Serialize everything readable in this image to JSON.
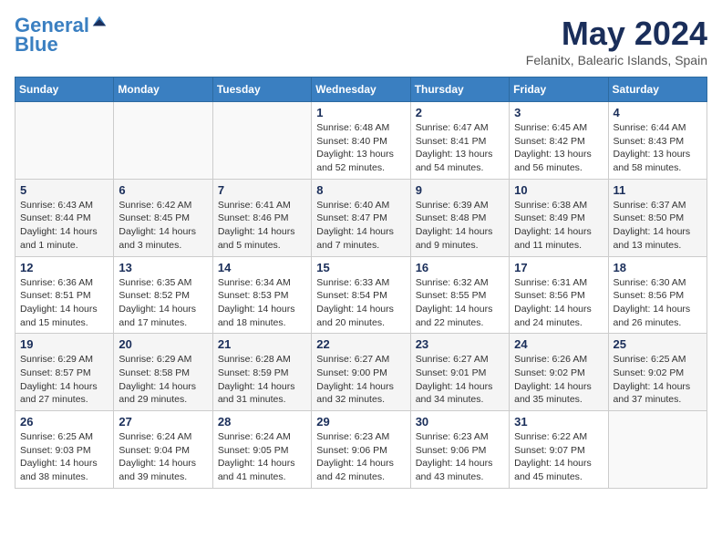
{
  "header": {
    "logo_line1": "General",
    "logo_line2": "Blue",
    "month": "May 2024",
    "location": "Felanitx, Balearic Islands, Spain"
  },
  "days_of_week": [
    "Sunday",
    "Monday",
    "Tuesday",
    "Wednesday",
    "Thursday",
    "Friday",
    "Saturday"
  ],
  "weeks": [
    [
      {
        "day": "",
        "info": ""
      },
      {
        "day": "",
        "info": ""
      },
      {
        "day": "",
        "info": ""
      },
      {
        "day": "1",
        "info": "Sunrise: 6:48 AM\nSunset: 8:40 PM\nDaylight: 13 hours\nand 52 minutes."
      },
      {
        "day": "2",
        "info": "Sunrise: 6:47 AM\nSunset: 8:41 PM\nDaylight: 13 hours\nand 54 minutes."
      },
      {
        "day": "3",
        "info": "Sunrise: 6:45 AM\nSunset: 8:42 PM\nDaylight: 13 hours\nand 56 minutes."
      },
      {
        "day": "4",
        "info": "Sunrise: 6:44 AM\nSunset: 8:43 PM\nDaylight: 13 hours\nand 58 minutes."
      }
    ],
    [
      {
        "day": "5",
        "info": "Sunrise: 6:43 AM\nSunset: 8:44 PM\nDaylight: 14 hours\nand 1 minute."
      },
      {
        "day": "6",
        "info": "Sunrise: 6:42 AM\nSunset: 8:45 PM\nDaylight: 14 hours\nand 3 minutes."
      },
      {
        "day": "7",
        "info": "Sunrise: 6:41 AM\nSunset: 8:46 PM\nDaylight: 14 hours\nand 5 minutes."
      },
      {
        "day": "8",
        "info": "Sunrise: 6:40 AM\nSunset: 8:47 PM\nDaylight: 14 hours\nand 7 minutes."
      },
      {
        "day": "9",
        "info": "Sunrise: 6:39 AM\nSunset: 8:48 PM\nDaylight: 14 hours\nand 9 minutes."
      },
      {
        "day": "10",
        "info": "Sunrise: 6:38 AM\nSunset: 8:49 PM\nDaylight: 14 hours\nand 11 minutes."
      },
      {
        "day": "11",
        "info": "Sunrise: 6:37 AM\nSunset: 8:50 PM\nDaylight: 14 hours\nand 13 minutes."
      }
    ],
    [
      {
        "day": "12",
        "info": "Sunrise: 6:36 AM\nSunset: 8:51 PM\nDaylight: 14 hours\nand 15 minutes."
      },
      {
        "day": "13",
        "info": "Sunrise: 6:35 AM\nSunset: 8:52 PM\nDaylight: 14 hours\nand 17 minutes."
      },
      {
        "day": "14",
        "info": "Sunrise: 6:34 AM\nSunset: 8:53 PM\nDaylight: 14 hours\nand 18 minutes."
      },
      {
        "day": "15",
        "info": "Sunrise: 6:33 AM\nSunset: 8:54 PM\nDaylight: 14 hours\nand 20 minutes."
      },
      {
        "day": "16",
        "info": "Sunrise: 6:32 AM\nSunset: 8:55 PM\nDaylight: 14 hours\nand 22 minutes."
      },
      {
        "day": "17",
        "info": "Sunrise: 6:31 AM\nSunset: 8:56 PM\nDaylight: 14 hours\nand 24 minutes."
      },
      {
        "day": "18",
        "info": "Sunrise: 6:30 AM\nSunset: 8:56 PM\nDaylight: 14 hours\nand 26 minutes."
      }
    ],
    [
      {
        "day": "19",
        "info": "Sunrise: 6:29 AM\nSunset: 8:57 PM\nDaylight: 14 hours\nand 27 minutes."
      },
      {
        "day": "20",
        "info": "Sunrise: 6:29 AM\nSunset: 8:58 PM\nDaylight: 14 hours\nand 29 minutes."
      },
      {
        "day": "21",
        "info": "Sunrise: 6:28 AM\nSunset: 8:59 PM\nDaylight: 14 hours\nand 31 minutes."
      },
      {
        "day": "22",
        "info": "Sunrise: 6:27 AM\nSunset: 9:00 PM\nDaylight: 14 hours\nand 32 minutes."
      },
      {
        "day": "23",
        "info": "Sunrise: 6:27 AM\nSunset: 9:01 PM\nDaylight: 14 hours\nand 34 minutes."
      },
      {
        "day": "24",
        "info": "Sunrise: 6:26 AM\nSunset: 9:02 PM\nDaylight: 14 hours\nand 35 minutes."
      },
      {
        "day": "25",
        "info": "Sunrise: 6:25 AM\nSunset: 9:02 PM\nDaylight: 14 hours\nand 37 minutes."
      }
    ],
    [
      {
        "day": "26",
        "info": "Sunrise: 6:25 AM\nSunset: 9:03 PM\nDaylight: 14 hours\nand 38 minutes."
      },
      {
        "day": "27",
        "info": "Sunrise: 6:24 AM\nSunset: 9:04 PM\nDaylight: 14 hours\nand 39 minutes."
      },
      {
        "day": "28",
        "info": "Sunrise: 6:24 AM\nSunset: 9:05 PM\nDaylight: 14 hours\nand 41 minutes."
      },
      {
        "day": "29",
        "info": "Sunrise: 6:23 AM\nSunset: 9:06 PM\nDaylight: 14 hours\nand 42 minutes."
      },
      {
        "day": "30",
        "info": "Sunrise: 6:23 AM\nSunset: 9:06 PM\nDaylight: 14 hours\nand 43 minutes."
      },
      {
        "day": "31",
        "info": "Sunrise: 6:22 AM\nSunset: 9:07 PM\nDaylight: 14 hours\nand 45 minutes."
      },
      {
        "day": "",
        "info": ""
      }
    ]
  ]
}
